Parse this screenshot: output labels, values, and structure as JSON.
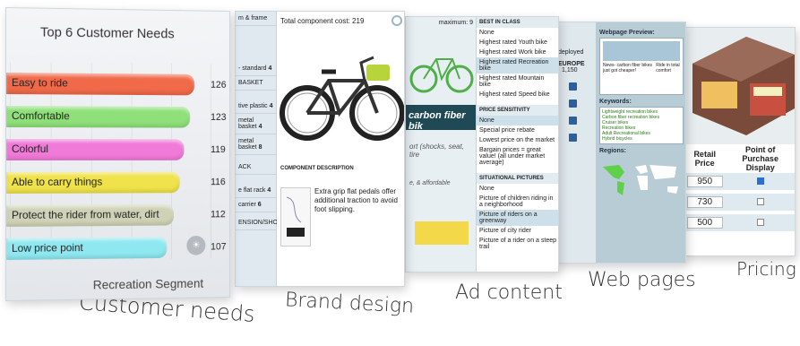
{
  "customer_needs": {
    "title": "Top 6 Customer Needs",
    "segment": "Recreation Segment",
    "bars": [
      {
        "label": "Easy to ride",
        "value": "126",
        "color": "#f06a4a"
      },
      {
        "label": "Comfortable",
        "value": "123",
        "color": "#8fe07a"
      },
      {
        "label": "Colorful",
        "value": "119",
        "color": "#f07ad8"
      },
      {
        "label": "Able to carry things",
        "value": "116",
        "color": "#efe24a"
      },
      {
        "label": "Protect the rider from water, dirt",
        "value": "112",
        "color": "#cfd2b6"
      },
      {
        "label": "Low price point",
        "value": "107",
        "color": "#8fe8f0"
      }
    ]
  },
  "brand_design": {
    "total_cost": "Total component cost: 219",
    "side": [
      {
        "label": "m & frame",
        "qty": ""
      },
      {
        "label": "- standard",
        "qty": "4"
      },
      {
        "label": "BASKET",
        "qty": ""
      },
      {
        "label": "tive plastic",
        "qty": "4"
      },
      {
        "label": "metal basket",
        "qty": "4"
      },
      {
        "label": "metal basket",
        "qty": "8"
      },
      {
        "label": "ACK",
        "qty": ""
      },
      {
        "label": "e flat rack",
        "qty": "4"
      },
      {
        "label": "carrier",
        "qty": "6"
      },
      {
        "label": "ENSION/SHOCK",
        "qty": ""
      }
    ],
    "component_heading": "COMPONENT DESCRIPTION",
    "component_text": "Extra grip flat pedals offer additional traction to avoid foot slipping."
  },
  "ad_content": {
    "maximum": "maximum: 9",
    "headline": "carbon fiber bik",
    "tag1": "ort (shocks, seat, tire",
    "tag2": "e, & affordable",
    "sections": [
      {
        "heading": "BEST IN CLASS",
        "options": [
          "None",
          "Highest rated Youth bike",
          "Highest rated Work bike",
          "Highest rated Recreation bike",
          "Highest rated Mountain bike",
          "Highest rated Speed bike"
        ],
        "selected": 3
      },
      {
        "heading": "PRICE SENSITIVITY",
        "options": [
          "None",
          "Special price rebate",
          "Lowest price on the market",
          "Bargain prices = great value! (all under market average)"
        ],
        "selected": 0
      },
      {
        "heading": "SITUATIONAL PICTURES",
        "options": [
          "None",
          "Picture of children riding in a neighborhood",
          "Picture of riders on a greenway",
          "Picture of city rider",
          "Picture of a rider on a steep trail"
        ],
        "selected": 2
      }
    ]
  },
  "web_pages": {
    "deployed": "deployed",
    "region": "EUROPE",
    "count": "1,150",
    "preview_label": "Webpage Preview:",
    "preview_items": [
      "News- carbon fiber bikes just got cheaper!",
      "Ride in total comfort"
    ],
    "keywords_label": "Keywords:",
    "keywords": [
      "Lightweight recreation bikes",
      "Carbon fiber recreation bikes",
      "Cruiser bikes",
      "Recreation bikes",
      "Adult Recreational bikes",
      "Hybrid bicycles"
    ],
    "regions_label": "Regions:"
  },
  "pricing": {
    "col1": "Retail Price",
    "col2": "Point of Purchase Display",
    "rows": [
      {
        "price": "950",
        "checked": true
      },
      {
        "price": "730",
        "checked": false
      },
      {
        "price": "500",
        "checked": false
      }
    ]
  },
  "captions": {
    "customer_needs": "Customer needs",
    "brand_design": "Brand design",
    "ad_content": "Ad content",
    "web_pages": "Web pages",
    "pricing": "Pricing"
  }
}
